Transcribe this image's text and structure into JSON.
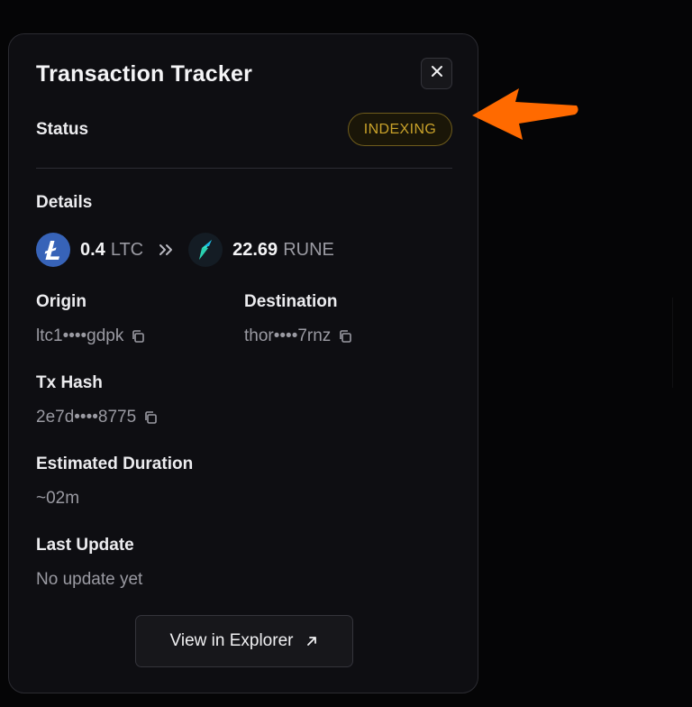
{
  "panel": {
    "title": "Transaction Tracker",
    "close_icon": "close-icon"
  },
  "status": {
    "label": "Status",
    "badge": "INDEXING",
    "badge_color": "#c9a22a"
  },
  "details": {
    "label": "Details",
    "from": {
      "amount": "0.4",
      "ticker": "LTC",
      "icon": "litecoin-icon",
      "color": "#3763b8"
    },
    "separator_icon": "double-chevron-right-icon",
    "to": {
      "amount": "22.69",
      "ticker": "RUNE",
      "icon": "thorchain-icon",
      "color": "#33e3c8"
    }
  },
  "origin": {
    "label": "Origin",
    "value": "ltc1••••gdpk"
  },
  "destination": {
    "label": "Destination",
    "value": "thor••••7rnz"
  },
  "tx_hash": {
    "label": "Tx Hash",
    "value": "2e7d••••8775"
  },
  "estimated_duration": {
    "label": "Estimated Duration",
    "value": "~02m"
  },
  "last_update": {
    "label": "Last Update",
    "value": "No update yet"
  },
  "explorer_button": {
    "label": "View in Explorer",
    "icon": "external-link-icon"
  },
  "annotation": {
    "icon": "arrow-pointer-icon",
    "color": "#ff6a00"
  }
}
